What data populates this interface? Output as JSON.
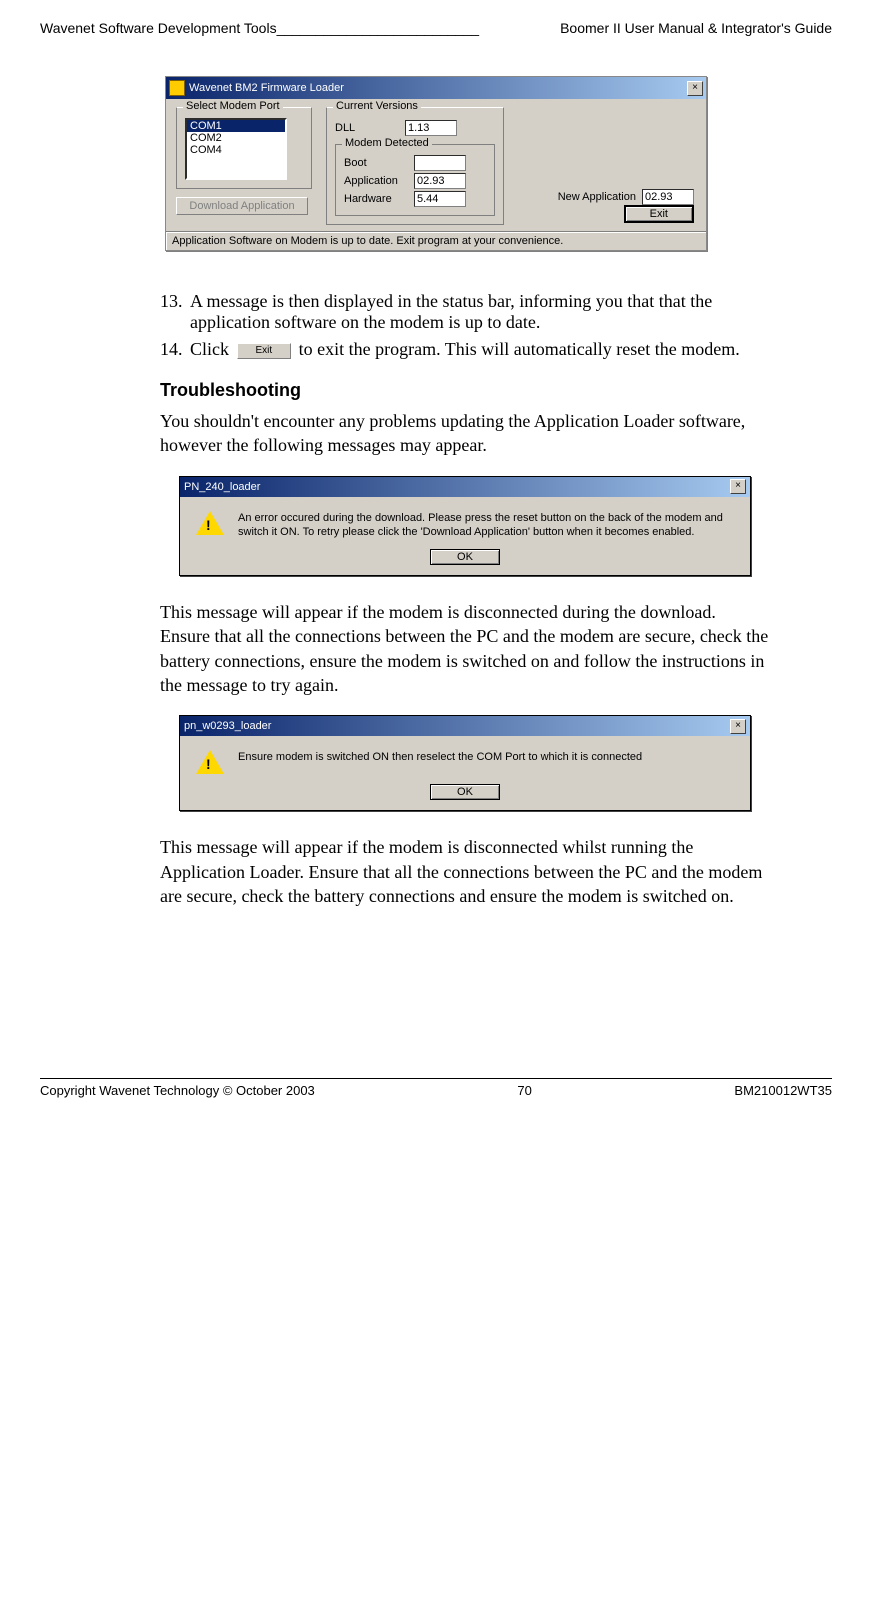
{
  "header": {
    "left": "Wavenet Software Development Tools",
    "right": "Boomer II User Manual & Integrator's Guide"
  },
  "loader": {
    "title": "Wavenet BM2 Firmware Loader",
    "selectModemPort": "Select Modem Port",
    "ports": {
      "p0": "COM1",
      "p1": "COM2",
      "p2": "COM4"
    },
    "downloadApp": "Download Application",
    "currentVersions": "Current Versions",
    "dllLabel": "DLL",
    "dllValue": "1.13",
    "modemDetected": "Modem Detected",
    "bootLabel": "Boot",
    "bootValue": "",
    "appLabel": "Application",
    "appValue": "02.93",
    "hwLabel": "Hardware",
    "hwValue": "5.44",
    "newAppLabel": "New Application",
    "newAppValue": "02.93",
    "exit": "Exit",
    "status": "Application Software on Modem is up to date. Exit program at your convenience."
  },
  "steps": {
    "n13": "13.",
    "t13": "A message is then displayed in the status bar, informing you that that the application software on the modem is up to date.",
    "n14": "14.",
    "t14a": "Click",
    "t14btn": "Exit",
    "t14b": "to exit the program. This will automatically reset the modem."
  },
  "troubleshooting": {
    "heading": "Troubleshooting",
    "intro": "You shouldn't encounter any problems updating the Application Loader software, however the following messages may appear."
  },
  "dlg1": {
    "title": "PN_240_loader",
    "text": "An error occured during the download. Please press the reset button on the back of the modem and switch it ON. To retry please click the 'Download Application' button when it becomes enabled.",
    "ok": "OK"
  },
  "para1": "This message will appear if the modem is disconnected during the download. Ensure that all the connections between the PC and the modem are secure, check the battery connections, ensure the modem is switched on and follow the instructions in the message to try again.",
  "dlg2": {
    "title": "pn_w0293_loader",
    "text": "Ensure modem is switched ON then reselect the COM Port to which it is connected",
    "ok": "OK"
  },
  "para2": "This message will appear if the modem is disconnected whilst running the Application Loader. Ensure that all the connections between the PC and the modem are secure, check the battery connections and ensure the modem is switched on.",
  "footer": {
    "left": "Copyright Wavenet Technology © October 2003",
    "center": "70",
    "right": "BM210012WT35"
  }
}
